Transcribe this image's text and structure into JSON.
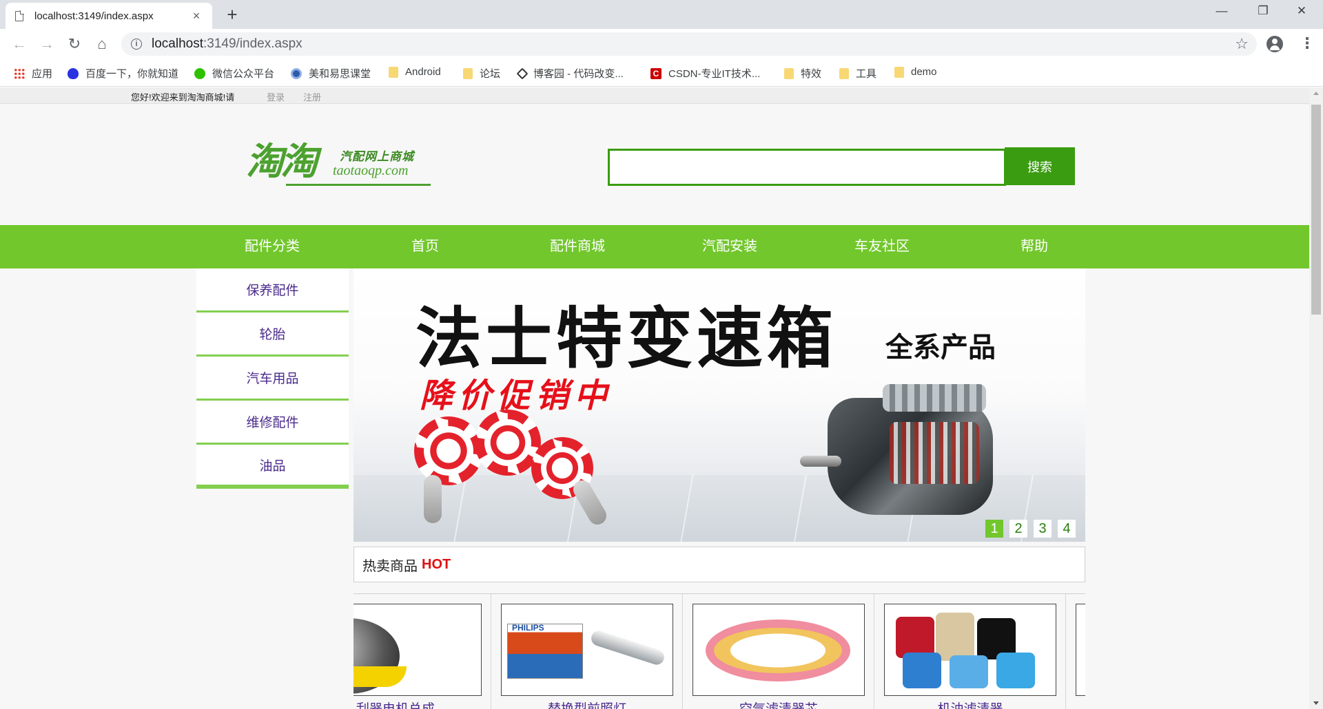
{
  "browser": {
    "tab_title": "localhost:3149/index.aspx",
    "tab_close": "×",
    "new_tab": "+",
    "url_host": "localhost",
    "url_path": ":3149/index.aspx",
    "win_minimize": "—",
    "win_restore": "❐",
    "win_close": "✕",
    "back": "←",
    "forward": "→",
    "reload": "↻",
    "home": "⌂",
    "star": "☆",
    "menu": "⋮",
    "info": "i",
    "bookmarks": [
      {
        "label": "应用",
        "icon": "apps-icon"
      },
      {
        "label": "百度一下，你就知道",
        "icon": "baidu-icon"
      },
      {
        "label": "微信公众平台",
        "icon": "wechat-icon"
      },
      {
        "label": "美和易思课堂",
        "icon": "meihe-icon"
      },
      {
        "label": "Android",
        "icon": "folder-icon"
      },
      {
        "label": "论坛",
        "icon": "folder-icon"
      },
      {
        "label": "博客园 - 代码改变...",
        "icon": "cnblogs-icon"
      },
      {
        "label": "CSDN-专业IT技术...",
        "icon": "csdn-icon"
      },
      {
        "label": "特效",
        "icon": "folder-icon"
      },
      {
        "label": "工具",
        "icon": "folder-icon"
      },
      {
        "label": "demo",
        "icon": "folder-icon"
      }
    ]
  },
  "page": {
    "topbar": {
      "welcome": "您好!欢迎来到淘淘商城!请",
      "login": "登录",
      "register": "注册"
    },
    "logo": {
      "big_text": "淘淘",
      "cn_text": "汽配网上商城",
      "domain": "taotaoqp.com"
    },
    "search": {
      "value": "",
      "button": "搜索"
    },
    "nav": [
      "配件分类",
      "首页",
      "配件商城",
      "汽配安装",
      "车友社区",
      "帮助"
    ],
    "categories": [
      "保养配件",
      "轮胎",
      "汽车用品",
      "维修配件",
      "油品"
    ],
    "banner": {
      "title": "法士特变速箱",
      "subtitle": "全系产品",
      "promo": "降价促销中",
      "slides": [
        "1",
        "2",
        "3",
        "4"
      ],
      "active_slide": 1
    },
    "hot": {
      "label": "热卖商品",
      "tag": "HOT"
    },
    "products": [
      {
        "name": "刮器电机总成"
      },
      {
        "name": "替换型前照灯"
      },
      {
        "name": "空气滤清器芯"
      },
      {
        "name": "机油滤清器"
      },
      {
        "name": ""
      }
    ],
    "product_brand_text": "PHILIPS"
  },
  "colors": {
    "nav_green": "#72c72c",
    "search_green": "#3a9c10",
    "category_text": "#4a2a8c",
    "hot_red": "#e01010",
    "promo_red": "#e6101a"
  }
}
